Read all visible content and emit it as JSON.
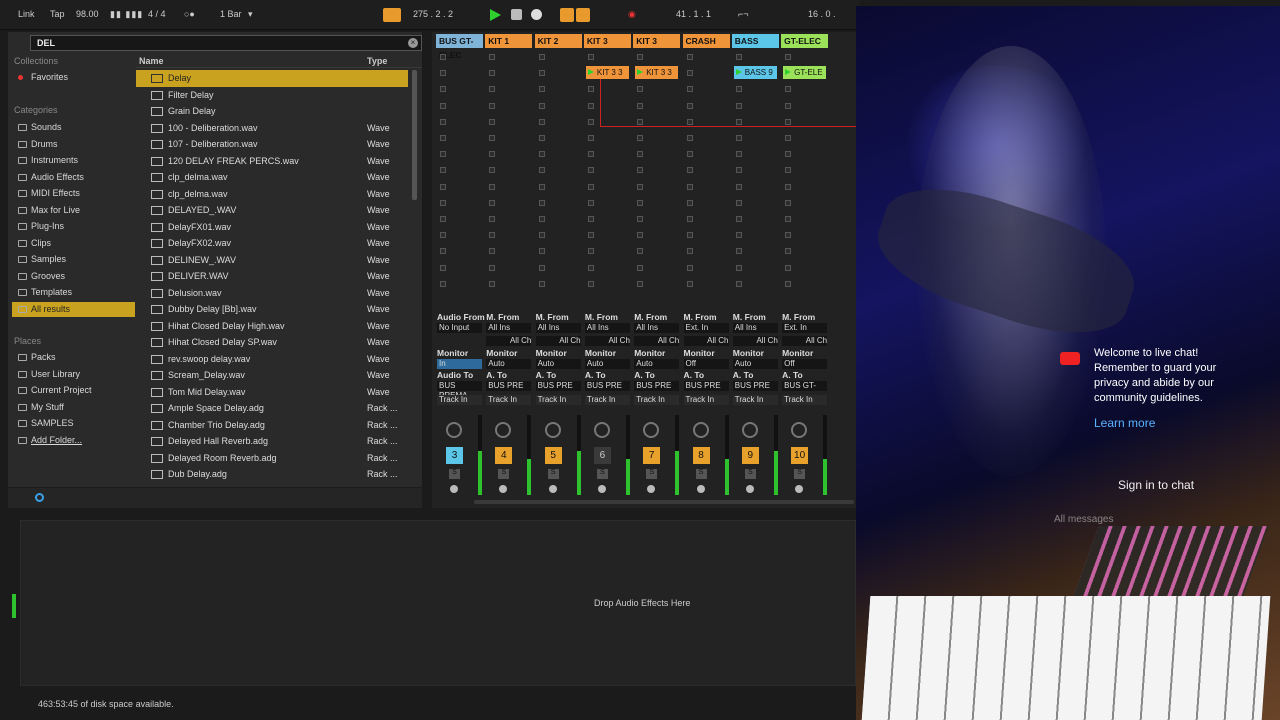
{
  "transport": {
    "link": "Link",
    "tap": "Tap",
    "tempo": "98.00",
    "signature": "4 / 4",
    "quantize": "1 Bar",
    "position": "275 .  2 .  2",
    "loop_start": "41 .  1 .  1",
    "loop_length": "16 .  0 ."
  },
  "browser": {
    "search_value": "DEL",
    "collections_label": "Collections",
    "collections": [
      "Favorites"
    ],
    "categories_label": "Categories",
    "categories": [
      "Sounds",
      "Drums",
      "Instruments",
      "Audio Effects",
      "MIDI Effects",
      "Max for Live",
      "Plug-Ins",
      "Clips",
      "Samples",
      "Grooves",
      "Templates",
      "All results"
    ],
    "places_label": "Places",
    "places": [
      "Packs",
      "User Library",
      "Current Project",
      "My Stuff",
      "SAMPLES",
      "Add Folder..."
    ],
    "col_name": "Name",
    "col_type": "Type",
    "items": [
      {
        "name": "Delay",
        "type": ""
      },
      {
        "name": "Filter Delay",
        "type": ""
      },
      {
        "name": "Grain Delay",
        "type": ""
      },
      {
        "name": "100 - Deliberation.wav",
        "type": "Wave"
      },
      {
        "name": "107 - Deliberation.wav",
        "type": "Wave"
      },
      {
        "name": "120 DELAY FREAK PERCS.wav",
        "type": "Wave"
      },
      {
        "name": "clp_delma.wav",
        "type": "Wave"
      },
      {
        "name": "clp_delma.wav",
        "type": "Wave"
      },
      {
        "name": "DELAYED_.WAV",
        "type": "Wave"
      },
      {
        "name": "DelayFX01.wav",
        "type": "Wave"
      },
      {
        "name": "DelayFX02.wav",
        "type": "Wave"
      },
      {
        "name": "DELINEW_.WAV",
        "type": "Wave"
      },
      {
        "name": "DELIVER.WAV",
        "type": "Wave"
      },
      {
        "name": "Delusion.wav",
        "type": "Wave"
      },
      {
        "name": "Dubby Delay [Bb].wav",
        "type": "Wave"
      },
      {
        "name": "Hihat Closed Delay High.wav",
        "type": "Wave"
      },
      {
        "name": "Hihat Closed Delay SP.wav",
        "type": "Wave"
      },
      {
        "name": "rev.swoop delay.wav",
        "type": "Wave"
      },
      {
        "name": "Scream_Delay.wav",
        "type": "Wave"
      },
      {
        "name": "Tom Mid Delay.wav",
        "type": "Wave"
      },
      {
        "name": "Ample Space Delay.adg",
        "type": "Rack ..."
      },
      {
        "name": "Chamber Trio Delay.adg",
        "type": "Rack ..."
      },
      {
        "name": "Delayed Hall Reverb.adg",
        "type": "Rack ..."
      },
      {
        "name": "Delayed Room Reverb.adg",
        "type": "Rack ..."
      },
      {
        "name": "Dub Delay.adg",
        "type": "Rack ..."
      }
    ]
  },
  "tracks": [
    {
      "name": "BUS GT-ELEC",
      "color": "#7fb4d8",
      "num": "3",
      "in_src": "No Input",
      "out": "BUS PREMA",
      "monitor": "In",
      "clip": ""
    },
    {
      "name": "KIT 1",
      "color": "#f0943a",
      "num": "4",
      "in_src": "All Ins",
      "out": "BUS PRE",
      "monitor": "Auto",
      "clip": ""
    },
    {
      "name": "KIT 2",
      "color": "#f0943a",
      "num": "5",
      "in_src": "All Ins",
      "out": "BUS PRE",
      "monitor": "Auto",
      "clip": ""
    },
    {
      "name": "KIT 3",
      "color": "#f0943a",
      "num": "6",
      "in_src": "All Ins",
      "out": "BUS PRE",
      "monitor": "Auto",
      "clip": "KIT 3 3"
    },
    {
      "name": "KIT 3",
      "color": "#f0943a",
      "num": "7",
      "in_src": "All Ins",
      "out": "BUS PRE",
      "monitor": "Auto",
      "clip": "KIT 3 3"
    },
    {
      "name": "CRASH",
      "color": "#f0943a",
      "num": "8",
      "in_src": "Ext. In",
      "out": "BUS PRE",
      "monitor": "Off",
      "clip": ""
    },
    {
      "name": "BASS",
      "color": "#5bc6e8",
      "num": "9",
      "in_src": "All Ins",
      "out": "BUS PRE",
      "monitor": "Auto",
      "clip": "BASS 9"
    },
    {
      "name": "GT-ELEC",
      "color": "#9be25a",
      "num": "10",
      "in_src": "Ext. In",
      "out": "BUS GT-",
      "monitor": "Off",
      "clip": "GT-ELE"
    }
  ],
  "mixer_labels": {
    "audio_from": "Audio From",
    "midi_from": "M. From",
    "monitor": "Monitor",
    "audio_to": "Audio To",
    "midi_to": "A. To",
    "track_in": "Track In",
    "all_channels": "All Ch",
    "in": "In",
    "auto": "Auto",
    "off": "Off"
  },
  "device_area": {
    "drop_text": "Drop Audio Effects Here"
  },
  "status": {
    "disk": "463:53:45 of disk space available."
  },
  "chat": {
    "welcome": "Welcome to live chat! Remember to guard your privacy and abide by our community guidelines.",
    "learn_more": "Learn more",
    "sign_in": "Sign in to chat",
    "all_messages": "All messages"
  }
}
